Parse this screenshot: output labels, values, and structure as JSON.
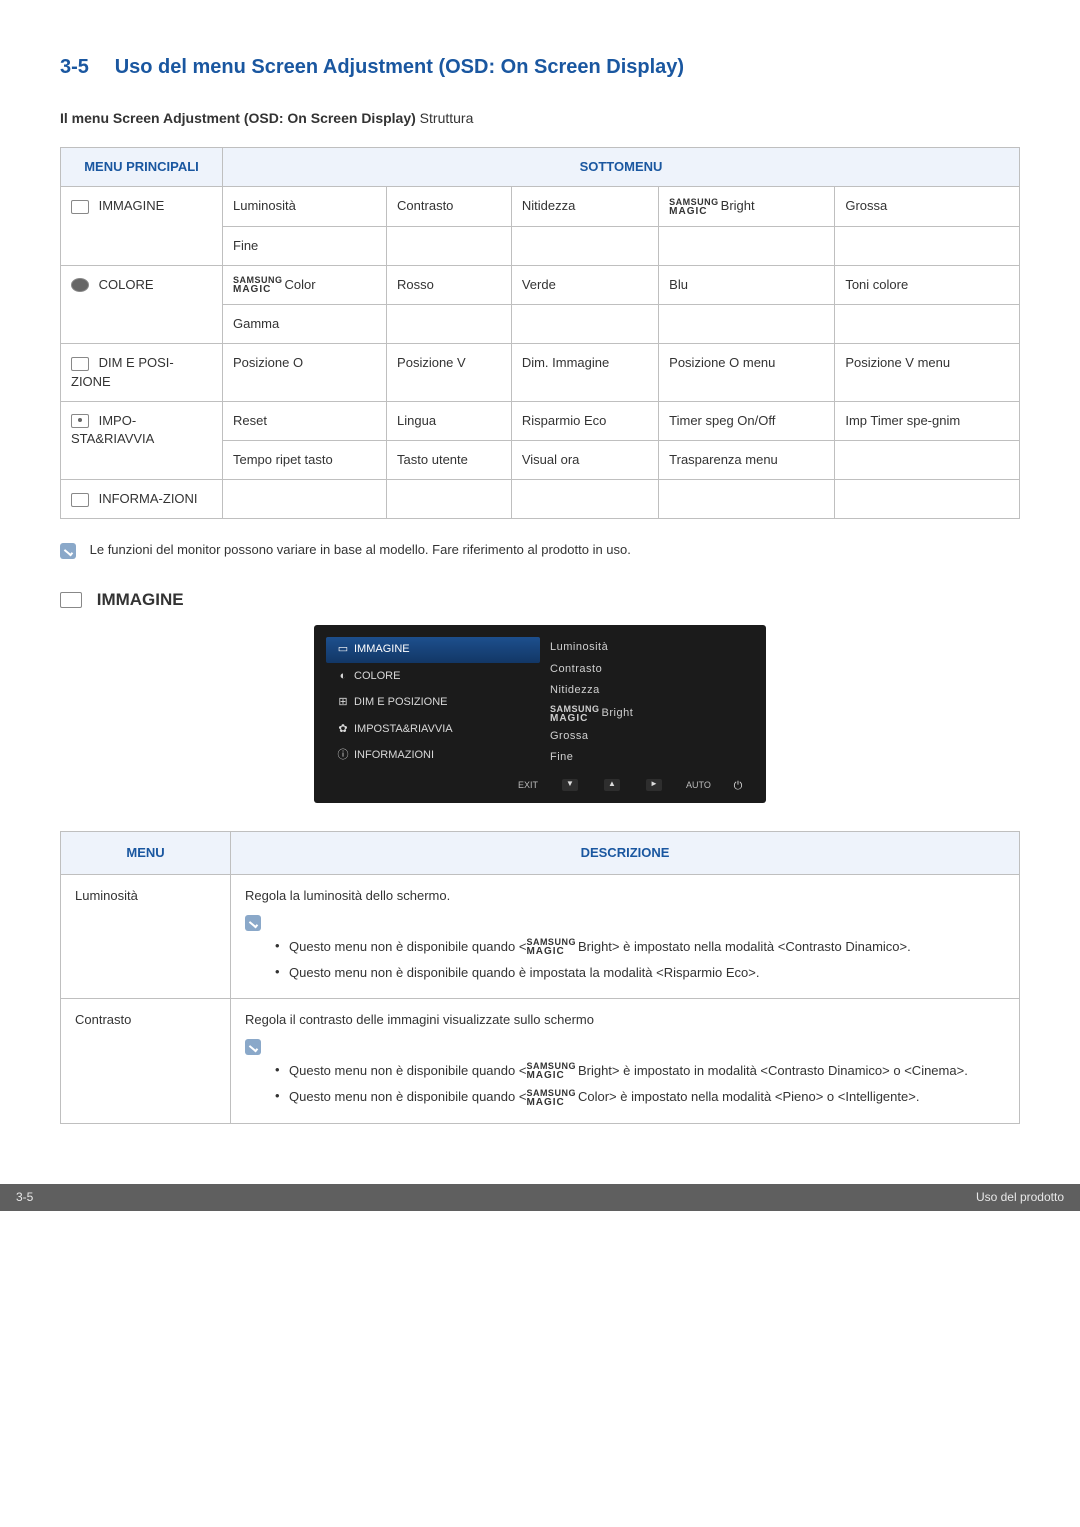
{
  "section_number": "3-5",
  "section_title": "Uso del menu Screen Adjustment (OSD: On Screen Display)",
  "subtitle_bold": "Il menu Screen Adjustment (OSD: On Screen Display)",
  "subtitle_rest": " Struttura",
  "table_headers": {
    "main": "MENU PRINCIPALI",
    "sub": "SOTTOMENU"
  },
  "brand_top": "SAMSUNG",
  "brand_bot": "MAGIC",
  "menu_rows": [
    {
      "label": "IMMAGINE",
      "rows": [
        [
          "Luminosità",
          "Contrasto",
          "Nitidezza",
          {
            "brand": true,
            "text": "Bright"
          },
          "Grossa"
        ],
        [
          "Fine",
          "",
          "",
          "",
          ""
        ]
      ]
    },
    {
      "label": "COLORE",
      "rows": [
        [
          {
            "brand": true,
            "text": "Color"
          },
          "Rosso",
          "Verde",
          "Blu",
          "Toni colore"
        ],
        [
          "Gamma",
          "",
          "",
          "",
          ""
        ]
      ]
    },
    {
      "label": "DIM E POSI-ZIONE",
      "rows": [
        [
          "Posizione O",
          "Posizione V",
          "Dim. Immagine",
          "Posizione O menu",
          "Posizione V menu"
        ]
      ]
    },
    {
      "label": "IMPO-STA&RIAVVIA",
      "rows": [
        [
          "Reset",
          "Lingua",
          "Risparmio Eco",
          "Timer speg On/Off",
          "Imp Timer spe-gnim"
        ],
        [
          "Tempo ripet tasto",
          "Tasto utente",
          "Visual ora",
          "Trasparenza menu",
          ""
        ]
      ]
    },
    {
      "label": "INFORMA-ZIONI",
      "rows": [
        [
          "",
          "",
          "",
          "",
          ""
        ]
      ]
    }
  ],
  "note_text": "Le funzioni del monitor possono variare in base al modello. Fare riferimento al prodotto in uso.",
  "osd_section_label": "IMMAGINE",
  "osd": {
    "left": [
      {
        "label": "IMMAGINE",
        "selected": true
      },
      {
        "label": "COLORE"
      },
      {
        "label": "DIM E POSIZIONE"
      },
      {
        "label": "IMPOSTA&RIAVVIA"
      },
      {
        "label": "INFORMAZIONI"
      }
    ],
    "right": [
      "Luminosità",
      "Contrasto",
      "Nitidezza",
      {
        "brand": true,
        "text": "Bright"
      },
      "Grossa",
      "Fine"
    ],
    "bottom": {
      "exit": "EXIT",
      "auto": "AUTO"
    }
  },
  "desc_headers": {
    "menu": "MENU",
    "desc": "DESCRIZIONE"
  },
  "desc_rows": [
    {
      "menu": "Luminosità",
      "lead": "Regola la luminosità dello schermo.",
      "bullets": [
        {
          "pre": "Questo menu non è disponibile quando <",
          "brand": true,
          "brand_text": "Bright",
          "post": "> è impostato nella modalità <Contrasto Dinamico>."
        },
        {
          "plain": "Questo menu non è disponibile quando è impostata la modalità <Risparmio Eco>."
        }
      ]
    },
    {
      "menu": "Contrasto",
      "lead": "Regola il contrasto delle immagini visualizzate sullo schermo",
      "bullets": [
        {
          "pre": "Questo menu non è disponibile quando <",
          "brand": true,
          "brand_text": "Bright",
          "post": "> è impostato in modalità <Contrasto Dinamico> o <Cinema>."
        },
        {
          "pre": "Questo menu non è disponibile quando <",
          "brand": true,
          "brand_text": "Color",
          "post": "> è impostato nella modalità <Pieno> o <Intelligente>."
        }
      ]
    }
  ],
  "footer": {
    "left": "3-5",
    "right": "Uso del prodotto"
  }
}
